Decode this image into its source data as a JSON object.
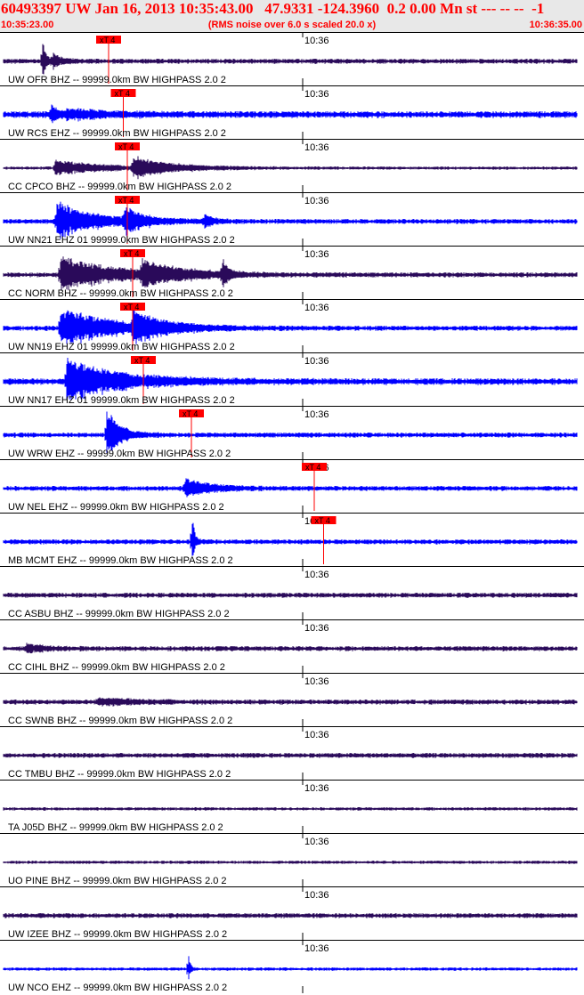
{
  "header": {
    "title": "60493397 UW Jan 16, 2013 10:35:43.00   47.9331 -124.3960  0.2 0.00 Mn st --- -- --  -1",
    "start_time": "10:35:23.00",
    "end_time": "10:36:35.00",
    "note": "(RMS noise over 6.0 s scaled 20.0 x)"
  },
  "chart_data": {
    "type": "line",
    "title": "60493397 UW Jan 16, 2013 10:35:43.00   47.9331 -124.3960  0.2 0.00 Mn st --- -- --  -1",
    "x_range": [
      "10:35:23.00",
      "10:36:35.00"
    ],
    "x_tick_label": "10:36",
    "pick_label": "xT 4",
    "series": [
      {
        "name": "UW OFR BHZ -- 99999.0km BW  HIGHPASS  2.0  2",
        "color": "#2a0a5a",
        "noise": 3,
        "events": [
          [
            48,
            20,
            4
          ],
          [
            60,
            8,
            10
          ]
        ],
        "pick": 48
      },
      {
        "name": "UW RCS EHZ -- 99999.0km BW  HIGHPASS  2.0  2",
        "color": "#0000ff",
        "noise": 4,
        "events": [
          [
            58,
            12,
            6
          ],
          [
            75,
            5,
            50
          ]
        ],
        "pick": 59
      },
      {
        "name": "CC CPCO BHZ -- 99999.0km BW  HIGHPASS  2.0  2",
        "color": "#2a0a5a",
        "noise": 2,
        "events": [
          [
            62,
            9,
            50
          ],
          [
            150,
            12,
            40
          ]
        ],
        "pick": 62
      },
      {
        "name": "UW NN21 EHZ 01 99999.0km BW  HIGHPASS  2.0  2",
        "color": "#0000ff",
        "noise": 3,
        "events": [
          [
            64,
            22,
            40
          ],
          [
            140,
            14,
            20
          ],
          [
            230,
            8,
            8
          ]
        ],
        "pick": 62
      },
      {
        "name": "CC NORM BHZ -- 99999.0km BW  HIGHPASS  2.0  2",
        "color": "#2a0a5a",
        "noise": 3,
        "events": [
          [
            68,
            20,
            60
          ],
          [
            160,
            14,
            40
          ],
          [
            250,
            16,
            6
          ]
        ],
        "pick": 66
      },
      {
        "name": "UW NN19 EHZ 01 99999.0km BW  HIGHPASS  2.0  2",
        "color": "#0000ff",
        "noise": 3,
        "events": [
          [
            68,
            22,
            60
          ],
          [
            150,
            16,
            30
          ]
        ],
        "pick": 66
      },
      {
        "name": "UW NN17 EHZ 01 99999.0km BW  HIGHPASS  2.0  2",
        "color": "#0000ff",
        "noise": 4,
        "events": [
          [
            75,
            24,
            60
          ]
        ],
        "pick": 74
      },
      {
        "name": "UW WRW EHZ -- 99999.0km BW  HIGHPASS  2.0  2",
        "color": "#0000ff",
        "noise": 3,
        "events": [
          [
            120,
            29,
            14
          ]
        ],
        "pick": 110
      },
      {
        "name": "UW NEL EHZ -- 99999.0km BW  HIGHPASS  2.0  2",
        "color": "#0000ff",
        "noise": 3,
        "events": [
          [
            208,
            10,
            30
          ]
        ],
        "pick": 202
      },
      {
        "name": "MB MCMT EHZ -- 99999.0km BW  HIGHPASS  2.0  2",
        "color": "#0000ff",
        "noise": 3,
        "events": [
          [
            216,
            29,
            3
          ]
        ],
        "pick": 209
      },
      {
        "name": "CC ASBU BHZ -- 99999.0km BW  HIGHPASS  2.0  2",
        "color": "#2a0a5a",
        "noise": 3,
        "events": []
      },
      {
        "name": "CC CIHL BHZ -- 99999.0km BW  HIGHPASS  2.0  2",
        "color": "#2a0a5a",
        "noise": 3,
        "events": [
          [
            30,
            5,
            20
          ]
        ]
      },
      {
        "name": "CC SWNB BHZ -- 99999.0km BW  HIGHPASS  2.0  2",
        "color": "#2a0a5a",
        "noise": 3,
        "events": [
          [
            110,
            4,
            40
          ]
        ]
      },
      {
        "name": "CC TMBU BHZ -- 99999.0km BW  HIGHPASS  2.0  2",
        "color": "#2a0a5a",
        "noise": 3,
        "events": []
      },
      {
        "name": "TA J05D BHZ -- 99999.0km BW  HIGHPASS  2.0  2",
        "color": "#2a0a5a",
        "noise": 2,
        "events": []
      },
      {
        "name": "UO PINE BHZ -- 99999.0km BW  HIGHPASS  2.0  2",
        "color": "#2a0a5a",
        "noise": 2,
        "events": []
      },
      {
        "name": "UW IZEE BHZ -- 99999.0km BW  HIGHPASS  2.0  2",
        "color": "#2a0a5a",
        "noise": 3,
        "events": []
      },
      {
        "name": "UW NCO EHZ -- 99999.0km BW  HIGHPASS  2.0  2",
        "color": "#0000ff",
        "noise": 2,
        "events": [
          [
            212,
            18,
            2
          ]
        ]
      }
    ]
  }
}
